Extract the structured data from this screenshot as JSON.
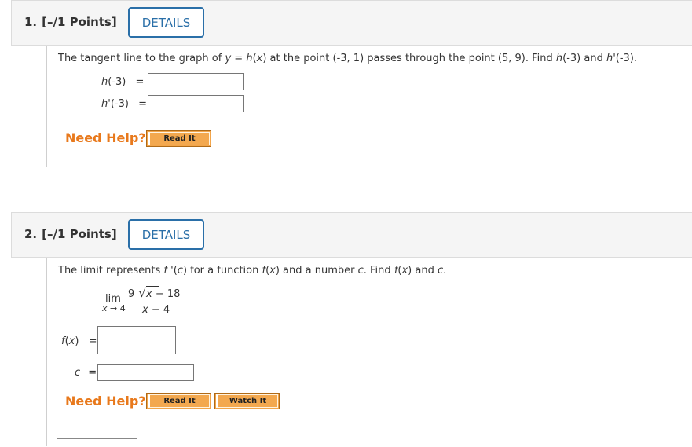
{
  "q1": {
    "number": "1.",
    "points": "[–/1 Points]",
    "details_label": "DETAILS",
    "text": {
      "p1": "The tangent line to the graph of ",
      "y": "y",
      "p2": " = ",
      "h1": "h",
      "p3": "(",
      "x1": "x",
      "p4": ") at the point (-3, 1) passes through the point (5, 9). Find ",
      "h2": "h",
      "p5": "(-3) and ",
      "h3": "h",
      "p6": "'(-3)."
    },
    "field1_label_fn": "h",
    "field1_label_arg": "(-3)",
    "field1_eq": "=",
    "field1_value": "",
    "field2_label_fn": "h",
    "field2_label_arg": "'(-3)",
    "field2_eq": "=",
    "field2_value": "",
    "need_help": "Need Help?",
    "read_it": "Read It"
  },
  "q2": {
    "number": "2.",
    "points": "[–/1 Points]",
    "details_label": "DETAILS",
    "text": {
      "p1": "The limit represents ",
      "f1": "f",
      "p2": " '(",
      "c1": "c",
      "p3": ") for a function ",
      "f2": "f",
      "p4": "(",
      "x1": "x",
      "p5": ") and a number ",
      "c2": "c",
      "p6": ". Find ",
      "f3": "f",
      "p7": "(",
      "x2": "x",
      "p8": ") and ",
      "c3": "c",
      "p9": "."
    },
    "limit": {
      "lim": "lim",
      "sub_x": "x",
      "sub_rest": " → 4",
      "num_coef": "9",
      "num_x": "x",
      "num_rest": " − 18",
      "den_x": "x",
      "den_rest": " − 4"
    },
    "fx_label_fn": "f",
    "fx_label_paren": "(",
    "fx_label_x": "x",
    "fx_label_close": ")",
    "fx_eq": "=",
    "fx_value": "",
    "c_label": "c",
    "c_eq": "=",
    "c_value": "",
    "need_help": "Need Help?",
    "read_it": "Read It",
    "watch_it": "Watch It"
  }
}
